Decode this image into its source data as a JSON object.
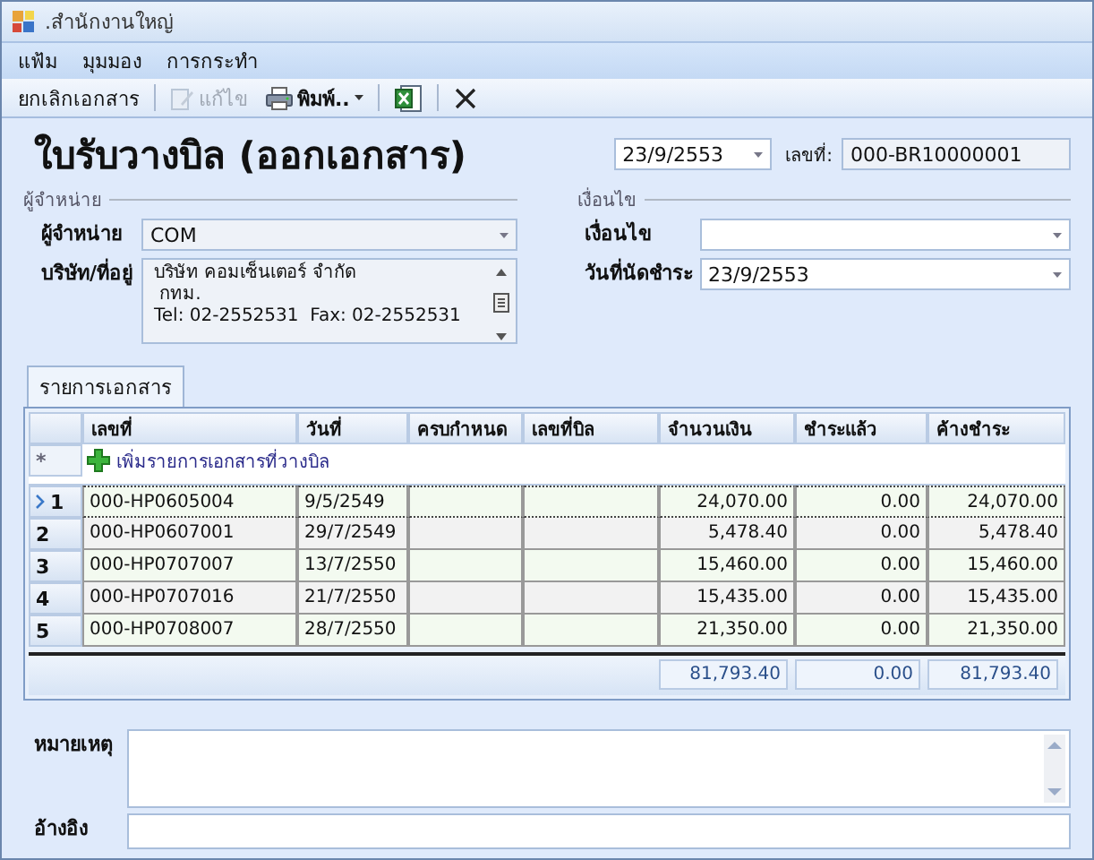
{
  "window": {
    "title": ".สำนักงานใหญ่"
  },
  "menu": [
    "แฟ้ม",
    "มุมมอง",
    "การกระทำ"
  ],
  "toolbar": [
    {
      "kind": "text",
      "label": "ยกเลิกเอกสาร",
      "disabled": false
    },
    {
      "kind": "edit",
      "label": "แก้ไข",
      "disabled": true
    },
    {
      "kind": "print",
      "label": "พิมพ์..",
      "disabled": false
    },
    {
      "kind": "excel"
    },
    {
      "kind": "close"
    }
  ],
  "heading": "ใบรับวางบิล (ออกเอกสาร)",
  "doc_date": "23/9/2553",
  "doc_number_label": "เลขที่:",
  "doc_number": "000-BR10000001",
  "vendor_group": {
    "title": "ผู้จำหน่าย",
    "vendor_label": "ผู้จำหน่าย",
    "vendor": "COM",
    "address_label": "บริษัท/ที่อยู่",
    "address_lines": [
      "บริษัท คอมเซ็นเตอร์ จำกัด",
      " กทม.",
      "Tel: 02-2552531  Fax: 02-2552531"
    ]
  },
  "terms_group": {
    "title": "เงื่อนไข",
    "terms_label": "เงื่อนไข",
    "due_label": "วันที่นัดชำระ",
    "due_date": "23/9/2553"
  },
  "tab": {
    "label": "รายการเอกสาร",
    "selected": true
  },
  "table": {
    "columns": [
      "เลขที่",
      "วันที่",
      "ครบกำหนด",
      "เลขที่บิล",
      "จำนวนเงิน",
      "ชำระแล้ว",
      "ค้างชำระ"
    ],
    "new_row_marker": "*",
    "new_row_label": "เพิ่มรายการเอกสารที่วางบิล",
    "rows": [
      {
        "index": "1",
        "selected": true,
        "cells": [
          "000-HP0605004",
          "9/5/2549",
          "",
          "",
          "24,070.00",
          "0.00",
          "24,070.00"
        ]
      },
      {
        "index": "2",
        "selected": false,
        "cells": [
          "000-HP0607001",
          "29/7/2549",
          "",
          "",
          "5,478.40",
          "0.00",
          "5,478.40"
        ]
      },
      {
        "index": "3",
        "selected": false,
        "cells": [
          "000-HP0707007",
          "13/7/2550",
          "",
          "",
          "15,460.00",
          "0.00",
          "15,460.00"
        ]
      },
      {
        "index": "4",
        "selected": false,
        "cells": [
          "000-HP0707016",
          "21/7/2550",
          "",
          "",
          "15,435.00",
          "0.00",
          "15,435.00"
        ]
      },
      {
        "index": "5",
        "selected": false,
        "cells": [
          "000-HP0708007",
          "28/7/2550",
          "",
          "",
          "21,350.00",
          "0.00",
          "21,350.00"
        ]
      }
    ],
    "totals": [
      "81,793.40",
      "0.00",
      "81,793.40"
    ]
  },
  "notes_label": "หมายเหตุ",
  "reference_label": "อ้างอิง"
}
